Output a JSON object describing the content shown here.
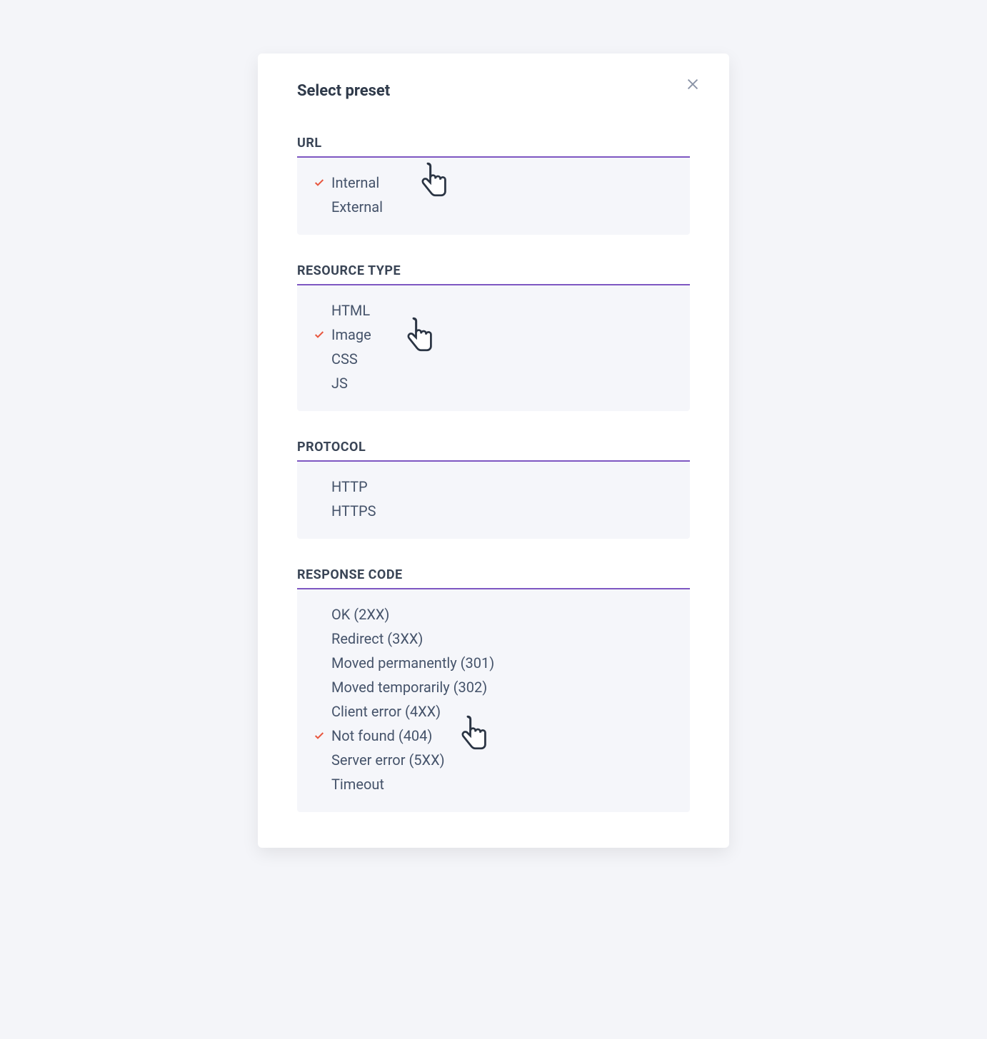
{
  "modal": {
    "title": "Select preset"
  },
  "sections": {
    "url": {
      "header": "URL",
      "options": [
        {
          "label": "Internal",
          "selected": true
        },
        {
          "label": "External",
          "selected": false
        }
      ]
    },
    "resource_type": {
      "header": "RESOURCE TYPE",
      "options": [
        {
          "label": "HTML",
          "selected": false
        },
        {
          "label": "Image",
          "selected": true
        },
        {
          "label": "CSS",
          "selected": false
        },
        {
          "label": "JS",
          "selected": false
        }
      ]
    },
    "protocol": {
      "header": "PROTOCOL",
      "options": [
        {
          "label": "HTTP",
          "selected": false
        },
        {
          "label": "HTTPS",
          "selected": false
        }
      ]
    },
    "response_code": {
      "header": "RESPONSE CODE",
      "options": [
        {
          "label": "OK (2XX)",
          "selected": false
        },
        {
          "label": "Redirect (3XX)",
          "selected": false
        },
        {
          "label": "Moved permanently (301)",
          "selected": false
        },
        {
          "label": "Moved temporarily (302)",
          "selected": false
        },
        {
          "label": "Client error (4XX)",
          "selected": false
        },
        {
          "label": "Not found (404)",
          "selected": true
        },
        {
          "label": "Server error (5XX)",
          "selected": false
        },
        {
          "label": "Timeout",
          "selected": false
        }
      ]
    }
  },
  "colors": {
    "accent_underline": "#7e57c2",
    "check_mark": "#e8573f",
    "text_primary": "#2f3a4a",
    "text_secondary": "#45536a",
    "panel_bg": "#f5f6fa",
    "page_bg": "#f4f5f9"
  }
}
